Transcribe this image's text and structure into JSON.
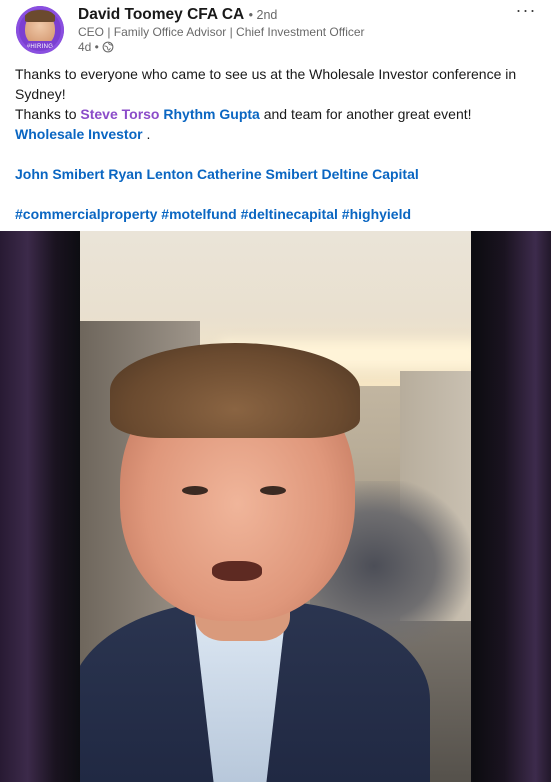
{
  "post": {
    "author": {
      "name": "David Toomey CFA CA",
      "degree": "• 2nd",
      "headline": "CEO | Family Office Advisor | Chief Investment Officer",
      "time": "4d •",
      "avatar_badge": "#HIRING"
    },
    "more_label": "···",
    "text": {
      "line1": "Thanks to everyone who came to see us at the Wholesale Investor conference in Sydney!",
      "line2_prefix": "Thanks to",
      "mention1": "Steve Torso",
      "mention2": "Rhythm Gupta",
      "line2_mid": "and team for another great event!",
      "mention3": "Wholesale Investor",
      "line2_suffix": ".",
      "tags_names": [
        "John Smibert",
        "Ryan Lenton",
        "Catherine Smibert",
        "Deltine Capital"
      ],
      "hashtags": [
        "#commercialproperty",
        "#motelfund",
        "#deltinecapital",
        "#highyield"
      ]
    },
    "media": {
      "type": "video"
    }
  },
  "colors": {
    "link": "#0a66c2",
    "mention": "#8b4cc9",
    "secondary_text": "rgba(0,0,0,0.6)"
  },
  "icons": {
    "visibility": "globe-icon",
    "menu": "more-horizontal-icon"
  }
}
